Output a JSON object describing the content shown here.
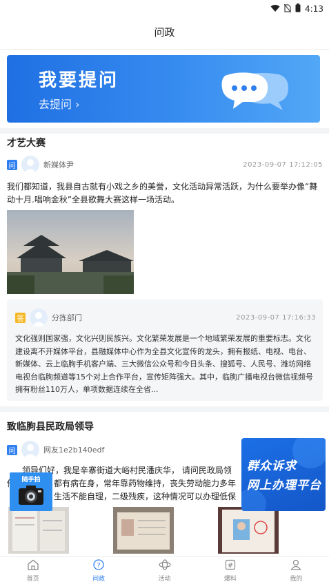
{
  "status_bar": {
    "time": "4:13"
  },
  "header": {
    "title": "问政"
  },
  "banner": {
    "title": "我要提问",
    "subtitle": "去提问 ›"
  },
  "questions": [
    {
      "title": "才艺大赛",
      "badge": "问",
      "user": "新媒体尹",
      "datetime": "2023-09-07  17:12:05",
      "body": "我们都知道，我县自古就有小戏之乡的美誉，文化活动异常活跃，为什么要举办像“舞动十月.唱响金秋”全县歌舞大赛这样一场活动。",
      "answer": {
        "badge": "答",
        "user": "分拣部门",
        "datetime": "2023-09-07  17:16:33",
        "body": "文化强则国家强，文化兴则民族兴。文化繁荣发展是一个地域繁荣发展的重要标志。文化建设离不开媒体平台，县融媒体中心作为全县文化宣传的龙头，拥有报纸、电视、电台、新媒体、云上临朐手机客户端、三大微信公众号和今日头条、搜狐号、人民号、潍坊网络电视台临朐频道等15个对上合作平台，宣传矩阵强大。其中，临朐广播电视台微信视频号拥有粉丝110万人，单项数据连续在全省..."
      }
    },
    {
      "title": "致临朐县民政局领导",
      "badge": "问",
      "user": "网友1e2b140edf",
      "body_line1": "领导们好，我是辛寨街道大峪村民潘庆华，  请问民政局领",
      "body_line2": "俺",
      "body_line2_main": "都有病在身，常年靠药物维持，丧失劳动能力多年",
      "body_line3": "生活不能自理，二级残疾，这种情况可以办理低保"
    }
  ],
  "floating": {
    "camera_label": "随手拍",
    "service_line1": "群众诉求",
    "service_line2": "网上办理平台"
  },
  "tabbar": {
    "tabs": [
      {
        "label": "首页",
        "icon": "home-icon",
        "active": false
      },
      {
        "label": "问政",
        "icon": "question-icon",
        "active": true
      },
      {
        "label": "活动",
        "icon": "activity-icon",
        "active": false
      },
      {
        "label": "爆料",
        "icon": "tip-icon",
        "active": false
      },
      {
        "label": "我的",
        "icon": "profile-icon",
        "active": false
      }
    ]
  },
  "colors": {
    "accent": "#2f7ff0",
    "answer_badge": "#f5b928"
  }
}
